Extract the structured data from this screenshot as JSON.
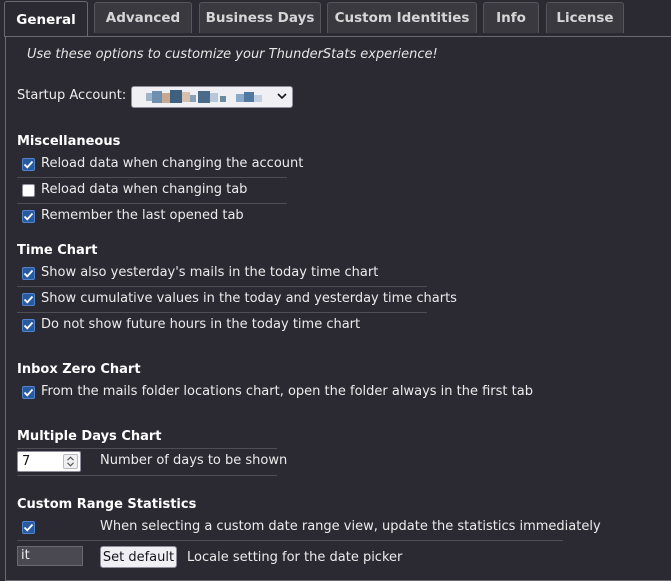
{
  "tabs": [
    {
      "label": "General",
      "active": true
    },
    {
      "label": "Advanced",
      "active": false
    },
    {
      "label": "Business Days",
      "active": false
    },
    {
      "label": "Custom Identities",
      "active": false
    },
    {
      "label": "Info",
      "active": false
    },
    {
      "label": "License",
      "active": false
    }
  ],
  "intro": "Use these options to customize your ThunderStats experience!",
  "startup": {
    "label": "Startup Account:"
  },
  "miscellaneous": {
    "heading": "Miscellaneous",
    "options": [
      {
        "label": "Reload data when changing the account",
        "checked": true
      },
      {
        "label": "Reload data when changing tab",
        "checked": false
      },
      {
        "label": "Remember the last opened tab",
        "checked": true
      }
    ]
  },
  "time_chart": {
    "heading": "Time Chart",
    "options": [
      {
        "label": "Show also yesterday's mails in the today time chart",
        "checked": true
      },
      {
        "label": "Show cumulative values in the today and yesterday time charts",
        "checked": true
      },
      {
        "label": "Do not show future hours in the today time chart",
        "checked": true
      }
    ]
  },
  "inbox_zero": {
    "heading": "Inbox Zero Chart",
    "options": [
      {
        "label": "From the mails folder locations chart, open the folder always in the first tab",
        "checked": true
      }
    ]
  },
  "multiple_days": {
    "heading": "Multiple Days Chart",
    "days_value": "7",
    "days_label": "Number of days to be shown"
  },
  "custom_range": {
    "heading": "Custom Range Statistics",
    "update_label": "When selecting a custom date range view, update the statistics immediately",
    "update_checked": true,
    "locale_value": "it",
    "set_default_label": "Set default",
    "locale_label": "Locale setting for the date picker"
  },
  "colors": {
    "background": "#2b2a33",
    "checkbox_checked": "#2a5a9e",
    "text": "#ececec"
  }
}
